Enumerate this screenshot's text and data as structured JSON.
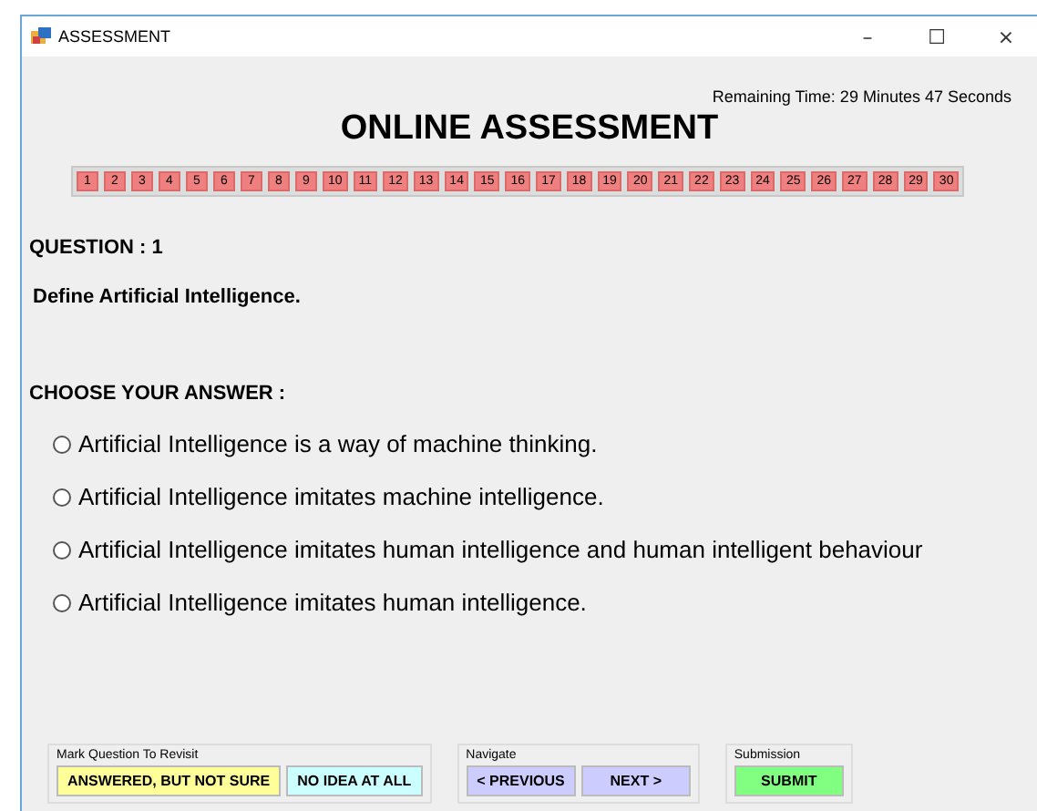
{
  "window": {
    "title": "ASSESSMENT",
    "controls": [
      "–",
      "☐",
      "×"
    ]
  },
  "timer": "Remaining Time: 29 Minutes 47 Seconds",
  "heading": "ONLINE ASSESSMENT",
  "question_numbers": [
    "1",
    "2",
    "3",
    "4",
    "5",
    "6",
    "7",
    "8",
    "9",
    "10",
    "11",
    "12",
    "13",
    "14",
    "15",
    "16",
    "17",
    "18",
    "19",
    "20",
    "21",
    "22",
    "23",
    "24",
    "25",
    "26",
    "27",
    "28",
    "29",
    "30"
  ],
  "question_label": "QUESTION : 1",
  "question_text": "Define Artificial Intelligence.",
  "answer_label": "CHOOSE YOUR ANSWER :",
  "options": [
    {
      "text": "Artificial Intelligence is a way of machine thinking.",
      "selected": false
    },
    {
      "text": "Artificial Intelligence imitates machine intelligence.",
      "selected": false
    },
    {
      "text": "Artificial Intelligence imitates human intelligence and human intelligent behaviour",
      "selected": false
    },
    {
      "text": "Artificial Intelligence imitates human intelligence.",
      "selected": false
    }
  ],
  "groups": [
    {
      "title": "Mark Question To Revisit",
      "buttons": [
        {
          "label": "ANSWERED, BUT NOT SURE",
          "color": "#ffff99"
        },
        {
          "label": "NO IDEA AT ALL",
          "color": "#ccffff"
        }
      ]
    },
    {
      "title": "Navigate",
      "buttons": [
        {
          "label": "< PREVIOUS",
          "color": "#ccccff"
        },
        {
          "label": "NEXT >",
          "color": "#ccccff"
        }
      ]
    },
    {
      "title": "Submission",
      "buttons": [
        {
          "label": "SUBMIT",
          "color": "#80ff80"
        }
      ]
    }
  ]
}
